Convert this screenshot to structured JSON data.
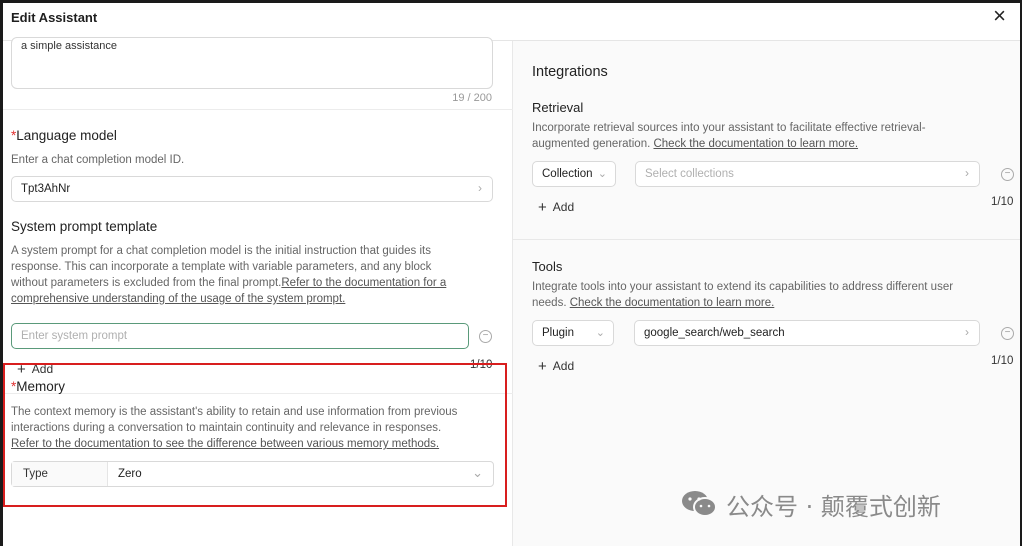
{
  "dialog": {
    "title": "Edit Assistant",
    "close_glyph": "×"
  },
  "description": {
    "value": "a simple assistance",
    "counter": "19 / 200"
  },
  "language_model": {
    "required_mark": "*",
    "label": "Language model",
    "help": "Enter a chat completion model ID.",
    "value": "Tpt3AhNr",
    "chevron": "›"
  },
  "system_prompt": {
    "label": "System prompt template",
    "help_line1": "A system prompt for a chat completion model is the initial instruction that guides its",
    "help_line2": "response. This can incorporate a template with variable parameters, and any block",
    "help_line3_text": "without parameters is excluded from the final prompt.",
    "help_line3_link": "Refer to the documentation for a",
    "help_line4_link": "comprehensive understanding of the usage of the system prompt.",
    "placeholder": "Enter system prompt",
    "add_label": "Add",
    "count": "1/10"
  },
  "memory": {
    "required_mark": "*",
    "label": "Memory",
    "help_line1": "The context memory is the assistant's ability to retain and use information from previous",
    "help_line2": "interactions during a conversation to maintain continuity and relevance in responses.",
    "help_link": "Refer to the documentation to see the difference between various memory methods.",
    "type_label": "Type",
    "type_value": "Zero"
  },
  "integrations": {
    "title": "Integrations",
    "retrieval": {
      "title": "Retrieval",
      "help_line1": "Incorporate retrieval sources into your assistant to facilitate effective retrieval-",
      "help_line2_text": "augmented generation. ",
      "help_link": "Check the documentation to learn more.",
      "source_type": "Collection",
      "placeholder": "Select collections",
      "add_label": "Add",
      "count": "1/10"
    },
    "tools": {
      "title": "Tools",
      "help_line1": "Integrate tools into your assistant to extend its capabilities to address different user",
      "help_line2_text": "needs. ",
      "help_link": "Check the documentation to learn more.",
      "tool_type": "Plugin",
      "value": "google_search/web_search",
      "add_label": "Add",
      "count": "1/10"
    }
  },
  "watermark": {
    "text": "公众号 · 颠覆式创新"
  },
  "colors": {
    "accent_required": "#e03131",
    "highlight_border": "#d81e1e",
    "focus_border": "#5a9a7a"
  }
}
